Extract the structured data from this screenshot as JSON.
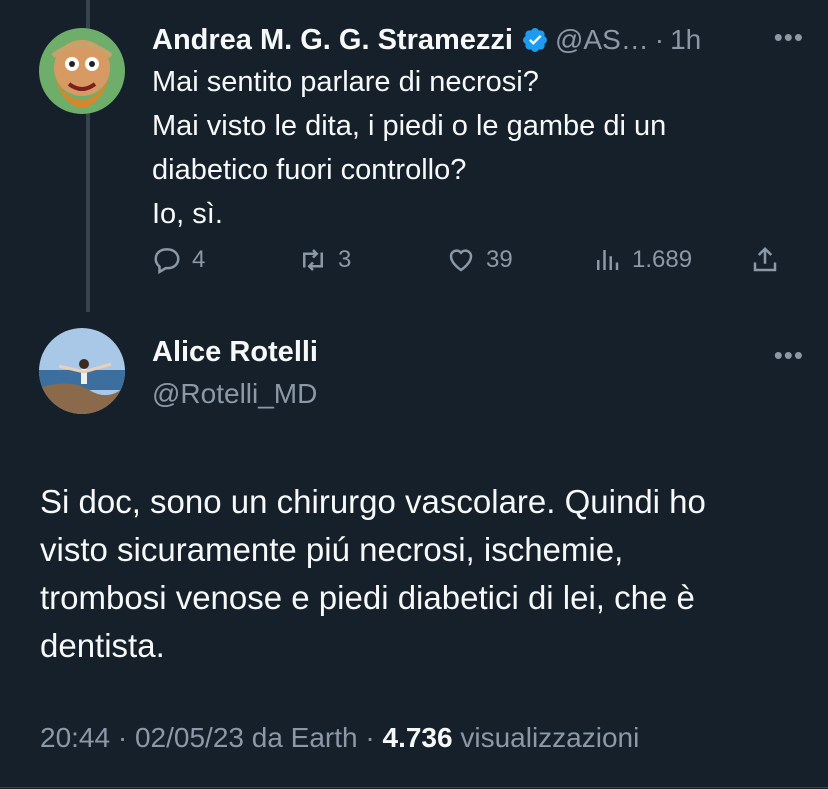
{
  "parent_tweet": {
    "name": "Andrea M. G. G. Stramezzi",
    "handle": "@AS…",
    "dot": "·",
    "time": "1h",
    "more": "•••",
    "text_lines": [
      "Mai sentito parlare di necrosi?",
      "Mai visto le dita, i piedi o le gambe di un",
      "diabetico fuori controllo?",
      "Io, sì."
    ],
    "actions": {
      "replies": "4",
      "retweets": "3",
      "likes": "39",
      "views": "1.689"
    }
  },
  "reply_tweet": {
    "name": "Alice Rotelli",
    "handle": "@Rotelli_MD",
    "more": "•••",
    "text_lines": [
      "Si doc, sono un chirurgo vascolare. Quindi ho",
      "visto sicuramente piú necrosi, ischemie,",
      "trombosi venose e piedi diabetici di lei, che è",
      "dentista."
    ],
    "meta": {
      "time": "20:44",
      "sep1": " · ",
      "date": "02/05/23",
      "source": " da Earth",
      "sep2": " · ",
      "views_count": "4.736",
      "views_label": " visualizzazioni"
    }
  },
  "colors": {
    "background": "#15202b",
    "text": "#f7f9f9",
    "secondary": "#8b98a5",
    "verified": "#1d9bf0"
  }
}
